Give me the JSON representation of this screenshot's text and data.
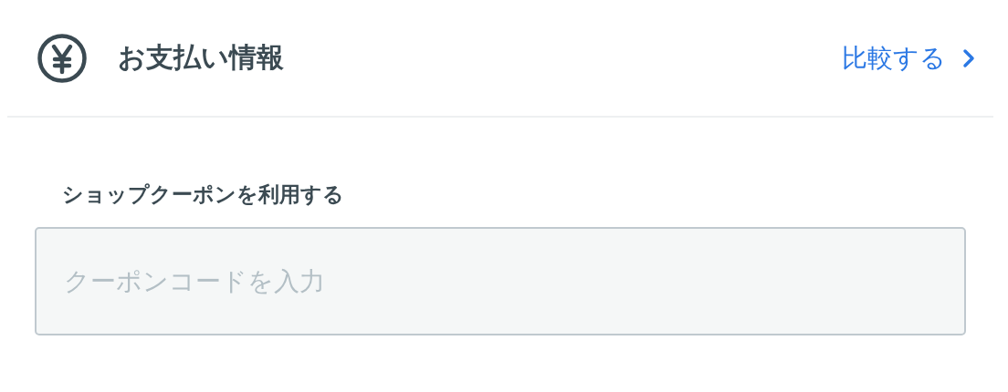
{
  "header": {
    "title": "お支払い情報",
    "compare_link": "比較する"
  },
  "coupon": {
    "label": "ショップクーポンを利用する",
    "placeholder": "クーポンコードを入力"
  }
}
